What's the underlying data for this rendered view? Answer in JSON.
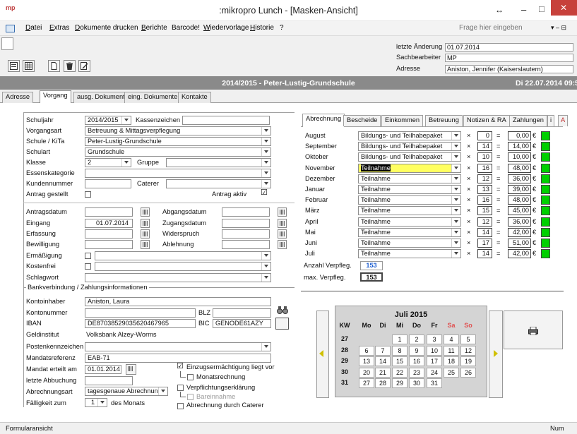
{
  "window": {
    "app_icon": "mp",
    "title": ":mikropro Lunch - [Masken-Ansicht]",
    "controls": {
      "resize_icon": "↔",
      "minimize_icon": "–",
      "maximize_icon": "□",
      "close_icon": "✕"
    }
  },
  "menu": {
    "items": [
      "Datei",
      "Extras",
      "Dokumente drucken",
      "Berichte",
      "Barcode!",
      "Wiedervorlage",
      "Historie",
      "?"
    ],
    "help_placeholder": "Frage hier eingeben"
  },
  "header": {
    "letzte_aenderung_label": "letzte Änderung",
    "letzte_aenderung": "01.07.2014",
    "sachbearbeiter_label": "Sachbearbeiter",
    "sachbearbeiter": "MP",
    "adresse_label": "Adresse",
    "adresse": "Aniston, Jennifer (Kaiserslautern)"
  },
  "banner": {
    "title": "2014/2015 - Peter-Lustig-Grundschule",
    "date": "Di 22.07.2014 09:5"
  },
  "tabs": [
    "Adresse",
    "Vorgang",
    "ausg. Dokumente",
    "eing. Dokumente",
    "Kontakte"
  ],
  "form": {
    "schuljahr_label": "Schuljahr",
    "schuljahr": "2014/2015",
    "kassenzeichen_label": "Kassenzeichen",
    "kassenzeichen": "",
    "vorgangsart_label": "Vorgangsart",
    "vorgangsart": "Betreuung & Mittagsverpflegung",
    "schule_label": "Schule / KiTa",
    "schule": "Peter-Lustig-Grundschule",
    "schulart_label": "Schulart",
    "schulart": "Grundschule",
    "klasse_label": "Klasse",
    "klasse": "2",
    "gruppe_label": "Gruppe",
    "gruppe": "",
    "essenskategorie_label": "Essenskategorie",
    "essenskategorie": "",
    "kundennummer_label": "Kundennummer",
    "kundennummer": "",
    "caterer_label": "Caterer",
    "caterer": "",
    "antrag_gestellt_label": "Antrag gestellt",
    "antrag_aktiv_label": "Antrag aktiv",
    "antrag_aktiv_mark": "☑",
    "antragsdatum_label": "Antragsdatum",
    "antragsdatum": "",
    "abgangsdatum_label": "Abgangsdatum",
    "abgangsdatum": "",
    "eingang_label": "Eingang",
    "eingang": "01.07.2014",
    "zugangsdatum_label": "Zugangsdatum",
    "zugangsdatum": "",
    "erfassung_label": "Erfassung",
    "erfassung": "",
    "widerspruch_label": "Widerspruch",
    "widerspruch": "",
    "bewilligung_label": "Bewilligung",
    "bewilligung": "",
    "ablehnung_label": "Ablehnung",
    "ablehnung": "",
    "ermaessigung_label": "Ermäßigung",
    "kostenfrei_label": "Kostenfrei",
    "schlagwort_label": "Schlagwort",
    "bank_section": "Bankverbindung / Zahlungsinformationen",
    "kontoinhaber_label": "Kontoinhaber",
    "kontoinhaber": "Aniston, Laura",
    "kontonummer_label": "Kontonummer",
    "kontonummer": "",
    "blz_label": "BLZ",
    "blz": "",
    "iban_label": "IBAN",
    "iban": "DE87038529035620467965",
    "bic_label": "BIC",
    "bic": "GENODE61AZY",
    "geldinstitut_label": "Geldinstitut",
    "geldinstitut": "Volksbank Alzey-Worms",
    "postenkennzeichen_label": "Postenkennzeichen",
    "postenkennzeichen": "",
    "mandatsreferenz_label": "Mandatsreferenz",
    "mandatsreferenz": "EAB-71",
    "mandat_label": "Mandat erteilt am",
    "mandat": "01.01.2014",
    "letzte_abbuchung_label": "letzte Abbuchung",
    "letzte_abbuchung": "",
    "abrechnungsart_label": "Abrechnungsart",
    "abrechnungsart": "tagesgenaue Abrechnung",
    "faelligkeit_label": "Fälligkeit zum",
    "faelligkeit": "1",
    "des_monats": "des Monats",
    "einzug_label": "Einzugsermächtigung liegt vor",
    "monatsrechnung_label": "Monatsrechnung",
    "verpflichtung_label": "Verpflichtungserklärung",
    "bareinnahme_label": "Bareinnahme",
    "caterer_abrechnung_label": "Abrechnung durch Caterer"
  },
  "right_tabs": [
    "Abrechnung",
    "Bescheide",
    "Einkommen",
    "Betreuung",
    "Notizen & RA",
    "Zahlungen",
    "i",
    "A"
  ],
  "billing": {
    "rows": [
      {
        "month": "August",
        "type": "Bildungs- und Teilhabepaket",
        "count": "0",
        "amount": "0,00"
      },
      {
        "month": "September",
        "type": "Bildungs- und Teilhabepaket",
        "count": "14",
        "amount": "14,00"
      },
      {
        "month": "Oktober",
        "type": "Bildungs- und Teilhabepaket",
        "count": "10",
        "amount": "10,00"
      },
      {
        "month": "November",
        "type": "Teilnahme",
        "count": "16",
        "amount": "48,00",
        "highlight": true
      },
      {
        "month": "Dezember",
        "type": "Teilnahme",
        "count": "12",
        "amount": "36,00"
      },
      {
        "month": "Januar",
        "type": "Teilnahme",
        "count": "13",
        "amount": "39,00"
      },
      {
        "month": "Februar",
        "type": "Teilnahme",
        "count": "16",
        "amount": "48,00"
      },
      {
        "month": "März",
        "type": "Teilnahme",
        "count": "15",
        "amount": "45,00"
      },
      {
        "month": "April",
        "type": "Teilnahme",
        "count": "12",
        "amount": "36,00"
      },
      {
        "month": "Mai",
        "type": "Teilnahme",
        "count": "14",
        "amount": "42,00"
      },
      {
        "month": "Juni",
        "type": "Teilnahme",
        "count": "17",
        "amount": "51,00"
      },
      {
        "month": "Juli",
        "type": "Teilnahme",
        "count": "14",
        "amount": "42,00"
      }
    ],
    "times": "×",
    "equals": "=",
    "currency": "€",
    "anzahl_label": "Anzahl Verpfleg.",
    "anzahl": "153",
    "max_label": "max. Verpfleg.",
    "max": "153"
  },
  "calendar": {
    "title": "Juli 2015",
    "kw_label": "KW",
    "weekdays": [
      "Mo",
      "Di",
      "Mi",
      "Do",
      "Fr",
      "Sa",
      "So"
    ],
    "weeks": [
      {
        "kw": "27",
        "days": [
          "",
          "",
          "1",
          "2",
          "3",
          "4",
          "5"
        ]
      },
      {
        "kw": "28",
        "days": [
          "6",
          "7",
          "8",
          "9",
          "10",
          "11",
          "12"
        ]
      },
      {
        "kw": "29",
        "days": [
          "13",
          "14",
          "15",
          "16",
          "17",
          "18",
          "19"
        ]
      },
      {
        "kw": "30",
        "days": [
          "20",
          "21",
          "22",
          "23",
          "24",
          "25",
          "26"
        ]
      },
      {
        "kw": "31",
        "days": [
          "27",
          "28",
          "29",
          "30",
          "31",
          "",
          ""
        ]
      }
    ]
  },
  "status": {
    "left": "Formularansicht",
    "right": "Num"
  },
  "colors": {
    "weekend": "#e05050",
    "banner": "#8a8a8a",
    "green": "#00d000",
    "highlight": "#ffff60",
    "count_blue": "#1f5fd0"
  }
}
